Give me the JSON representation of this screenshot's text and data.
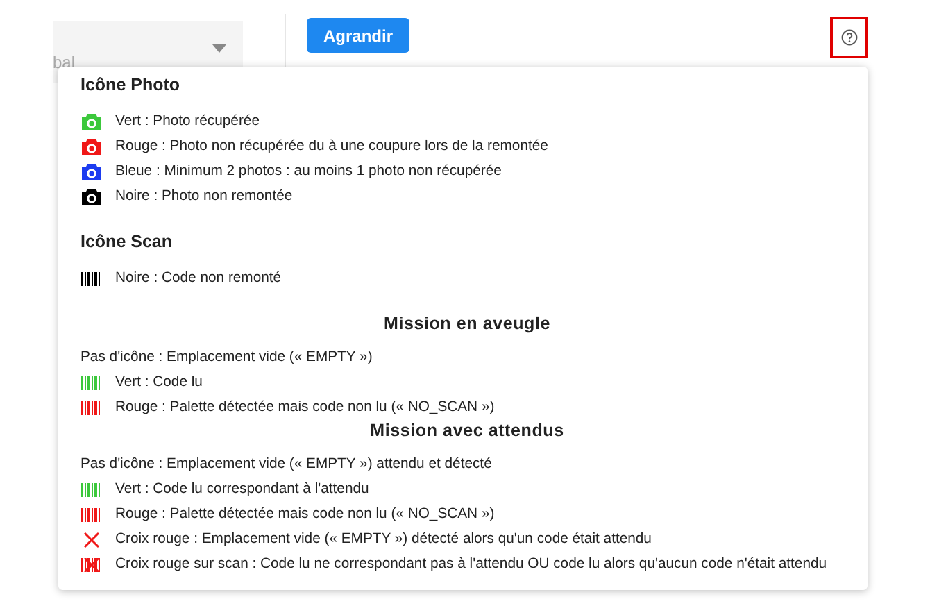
{
  "filter": {
    "placeholder": "bal"
  },
  "expand_button": "Agrandir",
  "help_popover": {
    "sections": [
      {
        "kind": "group",
        "title": "Icône Photo",
        "items": [
          {
            "kind": "camera",
            "color": "#3cc83c",
            "text": "Vert : Photo récupérée"
          },
          {
            "kind": "camera",
            "color": "#f01818",
            "text": "Rouge : Photo non récupérée du à une coupure lors de la remontée"
          },
          {
            "kind": "camera",
            "color": "#1c3cf0",
            "text": "Bleue : Minimum 2 photos : au moins 1 photo non récupérée"
          },
          {
            "kind": "camera",
            "color": "#000000",
            "text": "Noire : Photo non remontée"
          }
        ]
      },
      {
        "kind": "group",
        "title": "Icône Scan",
        "items": [
          {
            "kind": "barcode",
            "color": "#000000",
            "text": "Noire : Code non remonté"
          }
        ]
      },
      {
        "kind": "mission",
        "title": "Mission en aveugle",
        "items": [
          {
            "kind": "none",
            "text": "Pas d'icône : Emplacement vide (« EMPTY »)"
          },
          {
            "kind": "barcode",
            "color": "#3cc83c",
            "text": "Vert : Code lu"
          },
          {
            "kind": "barcode",
            "color": "#f01818",
            "text": "Rouge : Palette détectée mais code non lu (« NO_SCAN »)"
          }
        ]
      },
      {
        "kind": "mission",
        "title": "Mission avec attendus",
        "items": [
          {
            "kind": "none",
            "text": "Pas d'icône : Emplacement vide (« EMPTY ») attendu et détecté"
          },
          {
            "kind": "barcode",
            "color": "#3cc83c",
            "text": "Vert : Code lu correspondant à l'attendu"
          },
          {
            "kind": "barcode",
            "color": "#f01818",
            "text": "Rouge : Palette détectée mais code non lu (« NO_SCAN »)"
          },
          {
            "kind": "cross",
            "color": "#f01818",
            "text": "Croix rouge : Emplacement vide (« EMPTY ») détecté alors qu'un code était attendu"
          },
          {
            "kind": "barcode-cross",
            "color": "#f01818",
            "text": "Croix rouge sur scan : Code lu ne correspondant pas à l'attendu OU code lu alors qu'aucun code n'était attendu"
          }
        ]
      }
    ]
  }
}
